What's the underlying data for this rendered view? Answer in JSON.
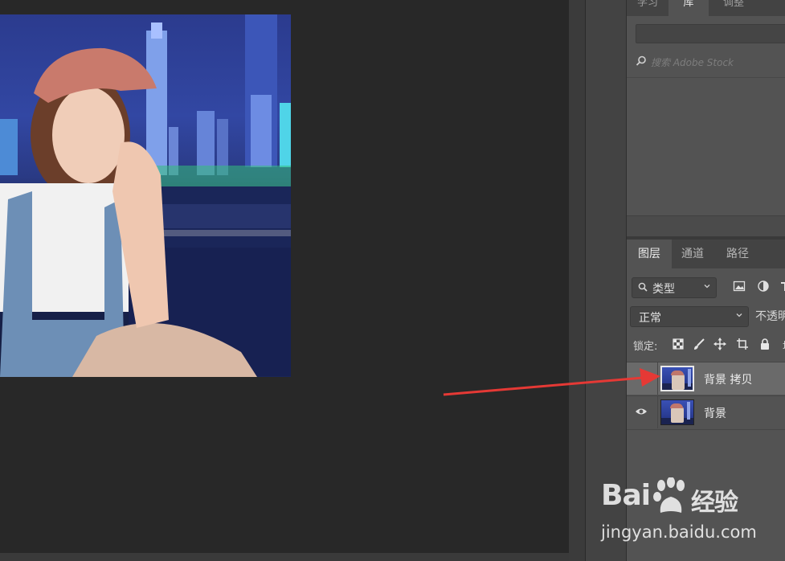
{
  "library_panel": {
    "tabs": [
      {
        "label": "学习",
        "active": false
      },
      {
        "label": "库",
        "active": true
      },
      {
        "label": "调整",
        "active": false
      }
    ],
    "search_placeholder": "搜索 Adobe Stock"
  },
  "layers_panel": {
    "tabs": [
      {
        "label": "图层",
        "active": true
      },
      {
        "label": "通道",
        "active": false
      },
      {
        "label": "路径",
        "active": false
      }
    ],
    "filter_kind": "类型",
    "blend_mode": "正常",
    "opacity_label": "不透明",
    "lock_label": "锁定:",
    "fill_label": "填",
    "layers": [
      {
        "name": "背景 拷贝",
        "selected": true,
        "visible": false
      },
      {
        "name": "背景",
        "selected": false,
        "visible": true
      }
    ]
  },
  "watermark": {
    "logo_text": "Bai",
    "logo_cn": "经验",
    "url": "jingyan.baidu.com"
  },
  "colors": {
    "panel_bg": "#535353",
    "canvas_bg": "#282828",
    "arrow": "#e53935"
  }
}
